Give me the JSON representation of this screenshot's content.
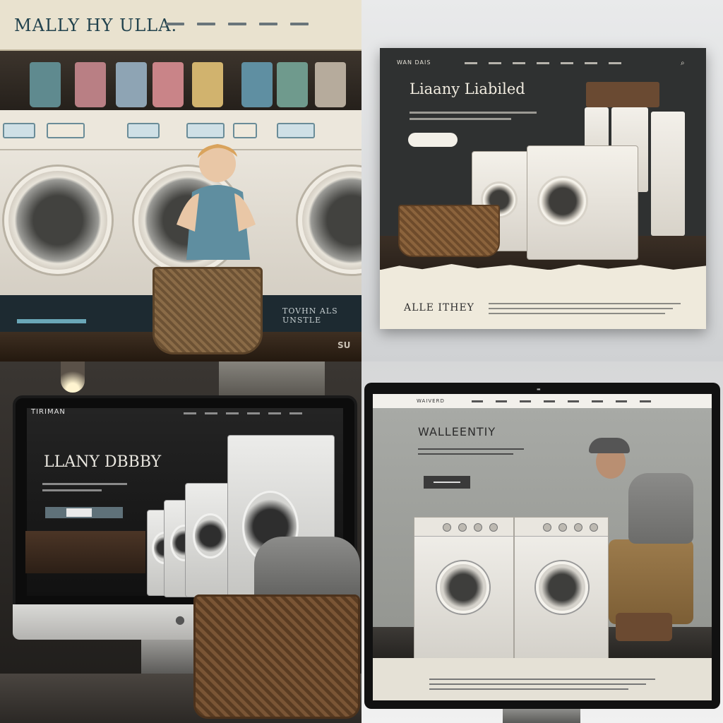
{
  "panels": {
    "p1": {
      "logo": "MALLY HY ULLA.",
      "baseband_left": "",
      "baseband_right": "TOVHN ALS UNSTLE",
      "floor_text": "SU"
    },
    "p2": {
      "logo": "WAN DAIS",
      "title": "Liaany Liabiled",
      "search_icon": "search-icon",
      "lower_title": "ALLE ITHEY"
    },
    "p3": {
      "logo": "TIRIMAN",
      "title": "LLANY DBBBY",
      "apple_icon": "apple-logo-icon"
    },
    "p4": {
      "logo": "WAIVERD",
      "title": "WALLEENTIY"
    }
  },
  "colors": {
    "p1_topbar": "#e9e2cf",
    "p1_band": "#1d2a31",
    "p1_accent": "#6aa7b8",
    "p2_dark": "#2f3131",
    "p2_cream": "#efeadc",
    "p3_screen": "#242424",
    "p4_nav": "#f2f0eb"
  }
}
